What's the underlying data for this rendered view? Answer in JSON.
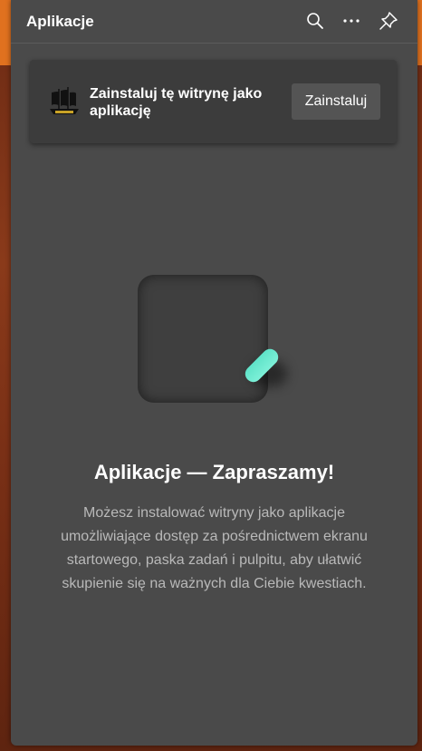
{
  "panel": {
    "title": "Aplikacje",
    "icons": [
      "search-icon",
      "more-icon",
      "pin-icon"
    ]
  },
  "install_card": {
    "logo": "pirate-ship-logo",
    "text": "Zainstaluj tę witrynę jako aplikację",
    "button_label": "Zainstaluj"
  },
  "empty_state": {
    "heading": "Aplikacje — Zapraszamy!",
    "description": "Możesz instalować witryny jako aplikacje umożliwiające dostęp za pośrednictwem ekranu startowego, paska zadań i pulpitu, aby ułatwić skupienie się na ważnych dla Ciebie kwestiach."
  },
  "colors": {
    "panel_bg": "#4a4a4a",
    "card_bg": "#3c3c3c",
    "accent_pill": "#6fe9d0",
    "browser_accent": "#e0711f"
  }
}
